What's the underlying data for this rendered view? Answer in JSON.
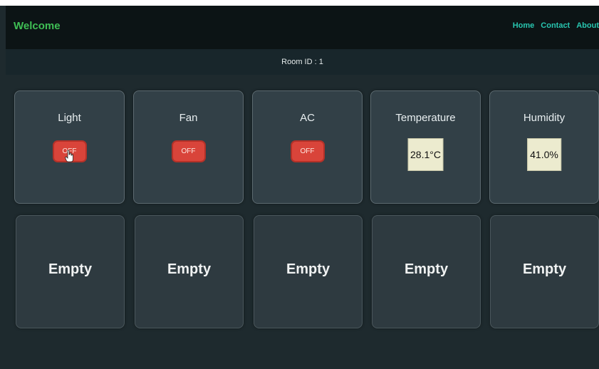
{
  "header": {
    "brand": "Welcome",
    "nav": [
      {
        "label": "Home"
      },
      {
        "label": "Contact"
      },
      {
        "label": "About"
      }
    ]
  },
  "room": {
    "label": "Room ID : 1"
  },
  "devices": [
    {
      "title": "Light",
      "state": "OFF"
    },
    {
      "title": "Fan",
      "state": "OFF"
    },
    {
      "title": "AC",
      "state": "OFF"
    }
  ],
  "sensors": [
    {
      "title": "Temperature",
      "value": "28.1°C"
    },
    {
      "title": "Humidity",
      "value": "41.0%"
    }
  ],
  "empty_slots": [
    {
      "label": "Empty"
    },
    {
      "label": "Empty"
    },
    {
      "label": "Empty"
    },
    {
      "label": "Empty"
    },
    {
      "label": "Empty"
    }
  ],
  "colors": {
    "brand": "#3fbf55",
    "nav_link": "#28c6b0",
    "off_button": "#d9443a",
    "value_box": "#ecebcf"
  }
}
